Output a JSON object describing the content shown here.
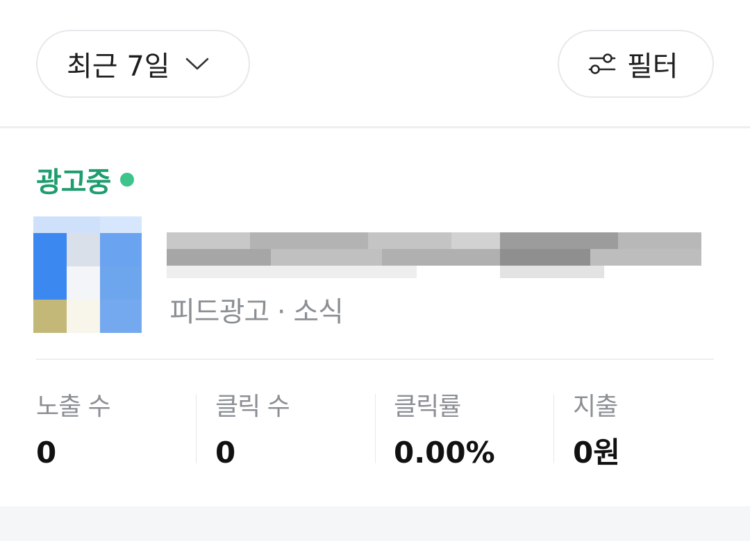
{
  "filters": {
    "period_label": "최근 7일",
    "filter_label": "필터"
  },
  "ad": {
    "status_label": "광고중",
    "status_color": "#1f9d6e",
    "subtitle": "피드광고 · 소식"
  },
  "stats": [
    {
      "label": "노출 수",
      "value": "0"
    },
    {
      "label": "클릭 수",
      "value": "0"
    },
    {
      "label": "클릭률",
      "value": "0.00%"
    },
    {
      "label": "지출",
      "value": "0원"
    }
  ],
  "icons": {
    "period_dropdown": "chevron-down-icon",
    "filter": "sliders-icon"
  }
}
